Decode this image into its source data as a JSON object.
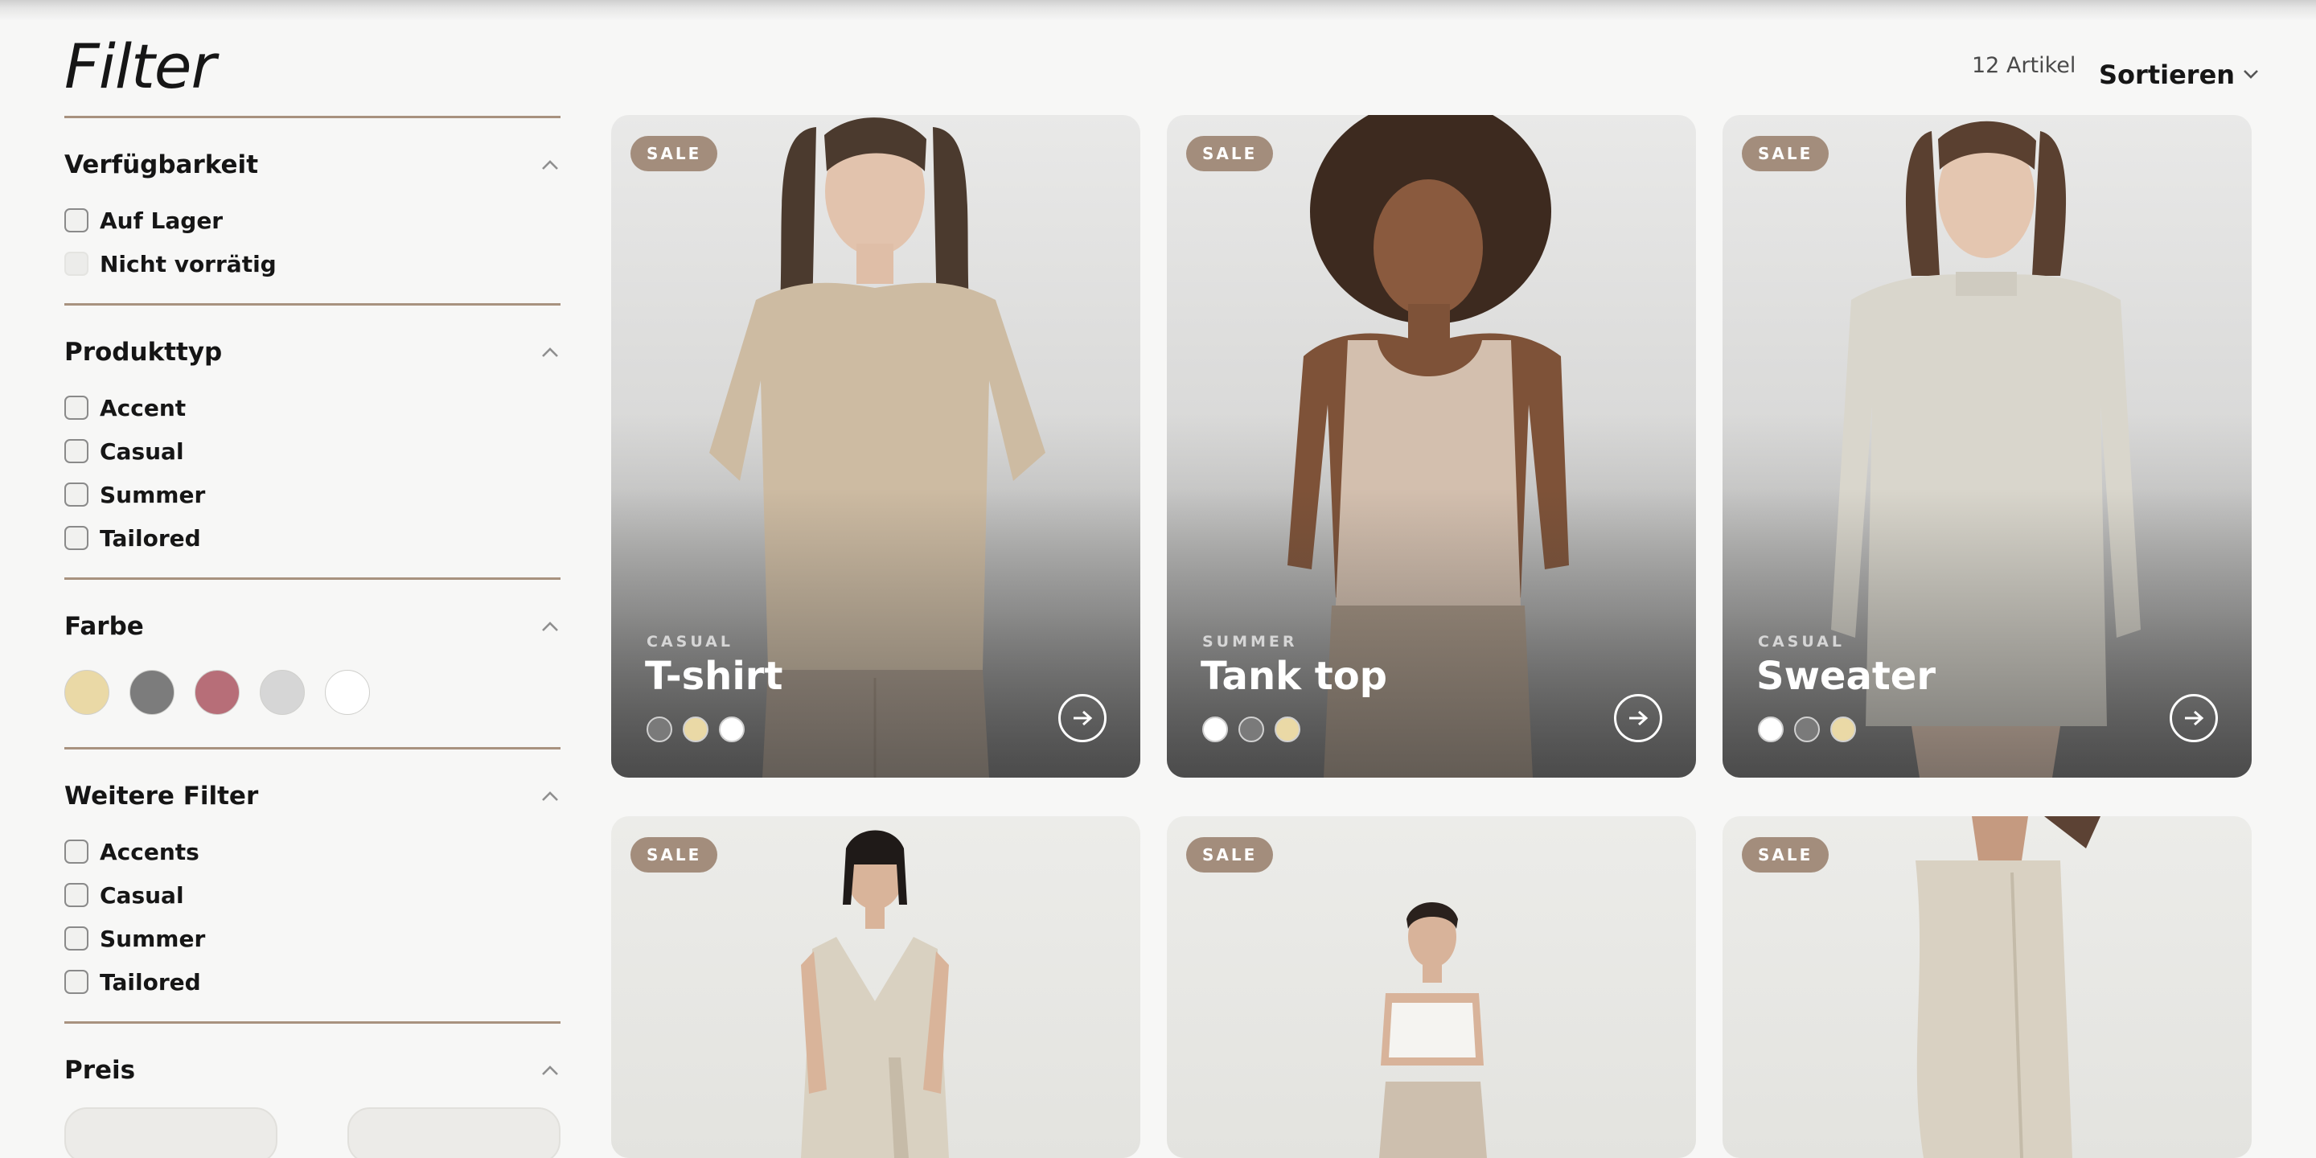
{
  "sidebar": {
    "title": "Filter",
    "sections": [
      {
        "title": "Verfügbarkeit",
        "options": [
          {
            "label": "Auf Lager",
            "disabled": false
          },
          {
            "label": "Nicht vorrätig",
            "disabled": true
          }
        ]
      },
      {
        "title": "Produkttyp",
        "options": [
          {
            "label": "Accent"
          },
          {
            "label": "Casual"
          },
          {
            "label": "Summer"
          },
          {
            "label": "Tailored"
          }
        ]
      },
      {
        "title": "Farbe",
        "swatches": [
          "#ead9a6",
          "#7c7c7c",
          "#b76e78",
          "#d6d6d6",
          "#ffffff"
        ]
      },
      {
        "title": "Weitere Filter",
        "options": [
          {
            "label": "Accents"
          },
          {
            "label": "Casual"
          },
          {
            "label": "Summer"
          },
          {
            "label": "Tailored"
          }
        ]
      },
      {
        "title": "Preis"
      }
    ]
  },
  "header": {
    "count": "12 Artikel",
    "sort_label": "Sortieren"
  },
  "products": [
    {
      "badge": "SALE",
      "category": "CASUAL",
      "name": "T-shirt",
      "colors": [
        "#7a7a7a",
        "#ead9a6",
        "#ffffff"
      ]
    },
    {
      "badge": "SALE",
      "category": "SUMMER",
      "name": "Tank top",
      "colors": [
        "#ffffff",
        "#7a7a7a",
        "#ead9a6"
      ]
    },
    {
      "badge": "SALE",
      "category": "CASUAL",
      "name": "Sweater",
      "colors": [
        "#ffffff",
        "#7a7a7a",
        "#ead9a6"
      ]
    },
    {
      "badge": "SALE"
    },
    {
      "badge": "SALE"
    },
    {
      "badge": "SALE"
    }
  ],
  "colors": {
    "accent": "#a38d7c",
    "divider": "#a8927f"
  }
}
